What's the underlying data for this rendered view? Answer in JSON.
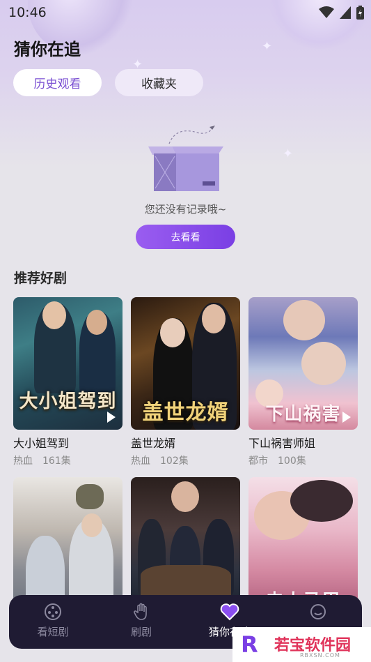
{
  "status_bar": {
    "time": "10:46"
  },
  "header": {
    "title": "猜你在追"
  },
  "tabs": [
    {
      "label": "历史观看",
      "active": true
    },
    {
      "label": "收藏夹",
      "active": false
    }
  ],
  "empty_state": {
    "message": "您还没有记录哦~",
    "button_label": "去看看"
  },
  "recommend": {
    "title": "推荐好剧",
    "items": [
      {
        "title": "大小姐驾到",
        "genre": "热血",
        "episodes": "161集",
        "poster_text": "大小姐驾到"
      },
      {
        "title": "盖世龙婿",
        "genre": "热血",
        "episodes": "102集",
        "poster_text": "盖世龙婿"
      },
      {
        "title": "下山祸害师姐",
        "genre": "都市",
        "episodes": "100集",
        "poster_text": "下山祸害"
      },
      {
        "title": "",
        "genre": "",
        "episodes": "",
        "poster_text": ""
      },
      {
        "title": "",
        "genre": "",
        "episodes": "",
        "poster_text": ""
      },
      {
        "title": "",
        "genre": "",
        "episodes": "",
        "poster_text": "夫人马甲"
      }
    ]
  },
  "bottom_nav": [
    {
      "label": "看短剧",
      "icon": "film-reel-icon",
      "active": false
    },
    {
      "label": "刷剧",
      "icon": "hand-swipe-icon",
      "active": false
    },
    {
      "label": "猜你在追",
      "icon": "heart-icon",
      "active": true
    },
    {
      "label": "",
      "icon": "profile-icon",
      "active": false
    }
  ],
  "watermark": {
    "brand": "若宝软件园",
    "logo_letter": "R",
    "site": "RBXSN.COM"
  },
  "colors": {
    "accent": "#7a3fe4",
    "nav_bg": "#1f1b33",
    "page_bg": "#e6e4ea"
  }
}
